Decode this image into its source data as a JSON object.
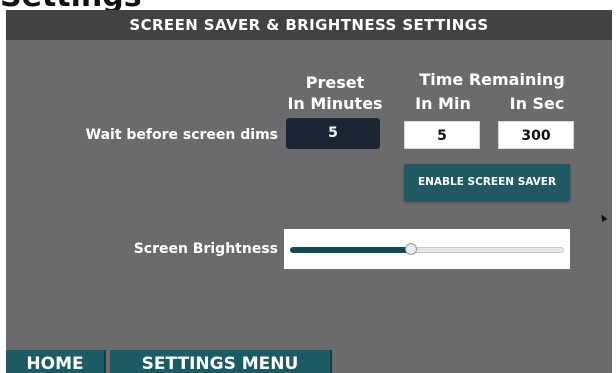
{
  "header": {
    "title": "SCREEN SAVER & BRIGHTNESS SETTINGS"
  },
  "page_title_glyph": "Settings",
  "columns": {
    "preset_line1": "Preset",
    "preset_line2": "In Minutes",
    "time_remaining": "Time Remaining",
    "in_min": "In Min",
    "in_sec": "In Sec"
  },
  "wait": {
    "label": "Wait before screen dims",
    "preset_value": "5",
    "remaining_min": "5",
    "remaining_sec": "300"
  },
  "enable_button": {
    "label": "ENABLE SCREEN SAVER"
  },
  "brightness": {
    "label": "Screen Brightness",
    "level": 0.44
  },
  "nav": {
    "home": "HOME",
    "settings_menu": "SETTINGS MENU"
  },
  "colors": {
    "panel": "#6b6a6c",
    "header": "#434144",
    "accent": "#1f5964",
    "preset_box": "#1c2534"
  },
  "icons": {
    "cursor": "cursor-arrow-icon"
  }
}
